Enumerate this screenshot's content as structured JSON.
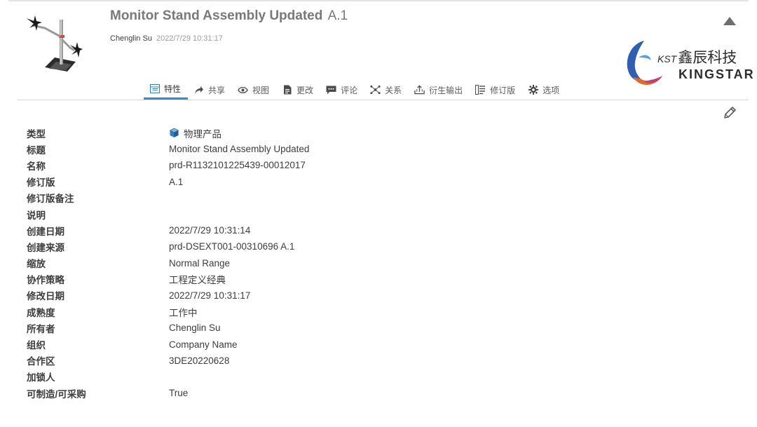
{
  "header": {
    "title": "Monitor Stand Assembly Updated",
    "revision": "A.1",
    "owner": "Chenglin Su",
    "modified": "2022/7/29 10:31:17"
  },
  "logo": {
    "brand_cn": "鑫辰科技",
    "brand_prefix": "KST",
    "brand_en": "KINGSTAR"
  },
  "tabs": [
    {
      "label": "特性",
      "icon": "table-icon",
      "active": true
    },
    {
      "label": "共享",
      "icon": "share-icon"
    },
    {
      "label": "视图",
      "icon": "eye-icon"
    },
    {
      "label": "更改",
      "icon": "document-icon"
    },
    {
      "label": "评论",
      "icon": "comment-icon"
    },
    {
      "label": "关系",
      "icon": "relations-icon"
    },
    {
      "label": "衍生输出",
      "icon": "derived-output-icon"
    },
    {
      "label": "修订版",
      "icon": "revision-icon"
    },
    {
      "label": "选项",
      "icon": "gear-icon"
    }
  ],
  "properties": [
    {
      "label": "类型",
      "value": "物理产品"
    },
    {
      "label": "标题",
      "value": "Monitor Stand Assembly Updated"
    },
    {
      "label": "名称",
      "value": "prd-R1132101225439-00012017"
    },
    {
      "label": "修订版",
      "value": "A.1"
    },
    {
      "label": "修订版备注",
      "value": ""
    },
    {
      "label": "说明",
      "value": ""
    },
    {
      "label": "创建日期",
      "value": "2022/7/29 10:31:14"
    },
    {
      "label": "创建来源",
      "value": "prd-DSEXT001-00310696 A.1"
    },
    {
      "label": "缩放",
      "value": "Normal Range"
    },
    {
      "label": "协作策略",
      "value": "工程定义经典"
    },
    {
      "label": "修改日期",
      "value": "2022/7/29 10:31:17"
    },
    {
      "label": "成熟度",
      "value": "工作中"
    },
    {
      "label": "所有者",
      "value": "Chenglin Su"
    },
    {
      "label": "组织",
      "value": "Company Name"
    },
    {
      "label": "合作区",
      "value": "3DE20220628"
    },
    {
      "label": "加锁人",
      "value": ""
    },
    {
      "label": "可制造/可采购",
      "value": "True"
    }
  ],
  "colors": {
    "accent": "#3b8bc9",
    "title": "#77797c",
    "text": "#3d3d3d",
    "logo_blue": "#2f5fb0",
    "logo_orange": "#e06a2c",
    "logo_magenta": "#c0407a"
  }
}
